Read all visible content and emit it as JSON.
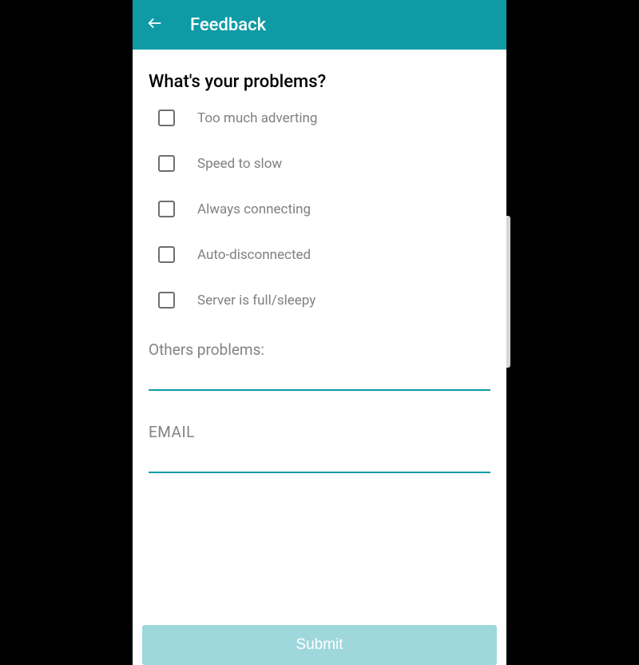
{
  "header": {
    "title": "Feedback"
  },
  "form": {
    "question": "What's your problems?",
    "options": [
      "Too much adverting",
      "Speed to slow",
      "Always connecting",
      "Auto-disconnected",
      "Server is full/sleepy"
    ],
    "others_label": "Others problems:",
    "others_value": "",
    "email_label": "EMAIL",
    "email_value": "",
    "submit_label": "Submit"
  }
}
